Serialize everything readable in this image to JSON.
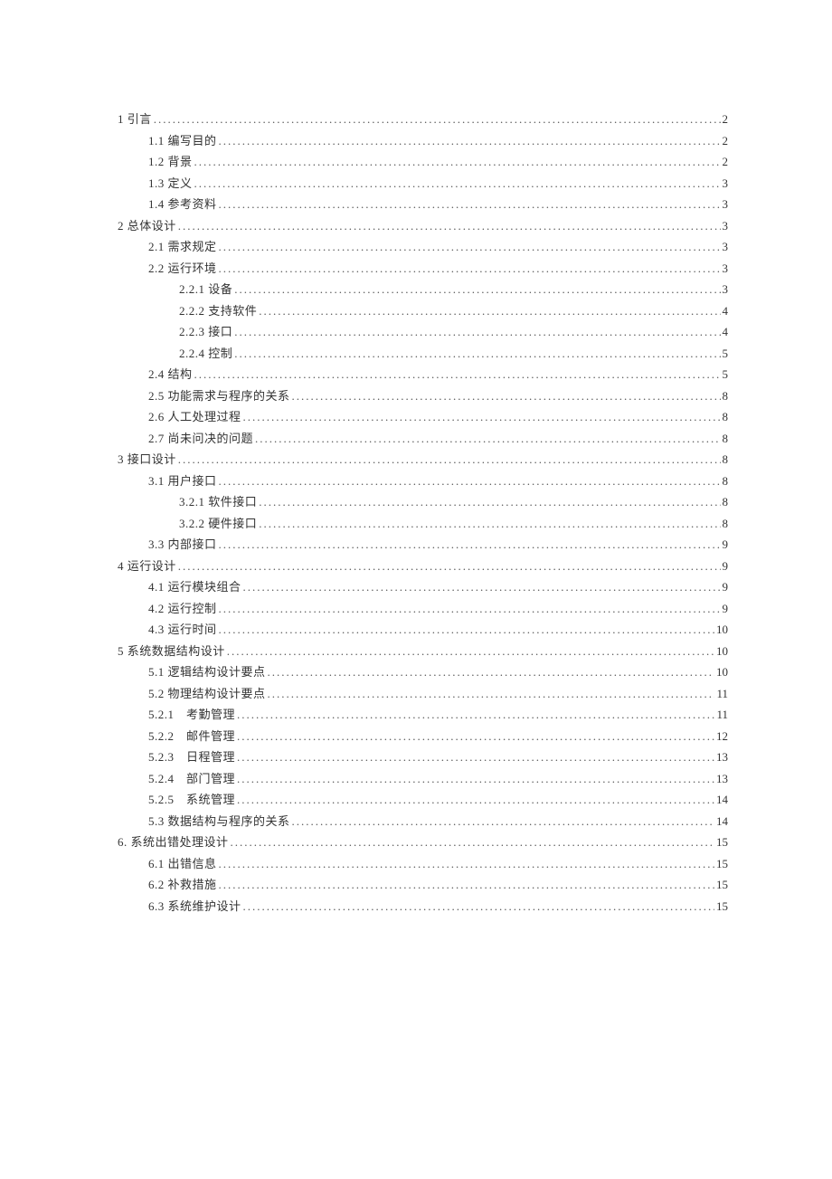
{
  "toc": [
    {
      "level": 0,
      "label": "1 引言",
      "page": "2"
    },
    {
      "level": 1,
      "label": "1.1 编写目的",
      "page": "2"
    },
    {
      "level": 1,
      "label": "1.2 背景",
      "page": "2"
    },
    {
      "level": 1,
      "label": "1.3 定义",
      "page": "3"
    },
    {
      "level": 1,
      "label": "1.4 参考资料",
      "page": "3"
    },
    {
      "level": 0,
      "label": "2 总体设计",
      "page": "3"
    },
    {
      "level": 1,
      "label": "2.1 需求规定",
      "page": "3"
    },
    {
      "level": 1,
      "label": "2.2 运行环境",
      "page": "3"
    },
    {
      "level": 2,
      "label": "2.2.1 设备",
      "page": "3"
    },
    {
      "level": 2,
      "label": "2.2.2 支持软件",
      "page": "4"
    },
    {
      "level": 2,
      "label": "2.2.3 接口 ",
      "page": " 4"
    },
    {
      "level": 2,
      "label": "2.2.4 控制",
      "page": "5"
    },
    {
      "level": 1,
      "label": "2.4 结构",
      "page": "5"
    },
    {
      "level": 1,
      "label": "2.5 功能需求与程序的关系 ",
      "page": " 8"
    },
    {
      "level": 1,
      "label": "2.6 人工处理过程",
      "page": "8"
    },
    {
      "level": 1,
      "label": "2.7 尚未问决的问题",
      "page": "8"
    },
    {
      "level": 0,
      "label": "3 接口设计",
      "page": "8"
    },
    {
      "level": 1,
      "label": "3.1 用户接口 ",
      "page": " 8"
    },
    {
      "level": 2,
      "label": "3.2.1 软件接口 ",
      "page": " 8"
    },
    {
      "level": 2,
      "label": "3.2.2 硬件接口 ",
      "page": " 8"
    },
    {
      "level": 1,
      "label": "3.3 内部接口 ",
      "page": " 9"
    },
    {
      "level": 0,
      "label": "4 运行设计",
      "page": "9"
    },
    {
      "level": 1,
      "label": "4.1 运行模块组合 ",
      "page": "9"
    },
    {
      "level": 1,
      "label": "4.2 运行控制",
      "page": "9"
    },
    {
      "level": 1,
      "label": "4.3 运行时间 ",
      "page": "10"
    },
    {
      "level": 0,
      "label": "5 系统数据结构设计 ",
      "page": "10"
    },
    {
      "level": 1,
      "label": "5.1 逻辑结构设计要点 ",
      "page": "10"
    },
    {
      "level": 1,
      "label": "5.2 物理结构设计要点 ",
      "page": "11"
    },
    {
      "level": 1,
      "label": "5.2.1　考勤管理 ",
      "page": "11"
    },
    {
      "level": 1,
      "label": "5.2.2　邮件管理 ",
      "page": "12"
    },
    {
      "level": 1,
      "label": "5.2.3　日程管理 ",
      "page": "13"
    },
    {
      "level": 1,
      "label": "5.2.4　部门管理 ",
      "page": "13"
    },
    {
      "level": 1,
      "label": "5.2.5　系统管理 ",
      "page": "14"
    },
    {
      "level": 1,
      "label": "5.3 数据结构与程序的关系 ",
      "page": "14"
    },
    {
      "level": 0,
      "label": "6. 系统出错处理设计 ",
      "page": "15"
    },
    {
      "level": 1,
      "label": "6.1 出错信息 ",
      "page": "15"
    },
    {
      "level": 1,
      "label": "6.2 补救措施 ",
      "page": "15"
    },
    {
      "level": 1,
      "label": "6.3 系统维护设计 ",
      "page": "15"
    }
  ]
}
